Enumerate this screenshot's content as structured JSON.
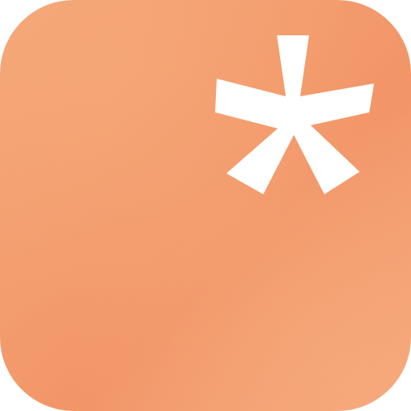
{
  "app_icon": {
    "shape": "rounded-square",
    "symbol": "asterisk-icon",
    "colors": {
      "background": "#f4a070",
      "gradient_light": "#f5a97c",
      "gradient_dark": "#f29568",
      "glyph": "#ffffff"
    }
  }
}
